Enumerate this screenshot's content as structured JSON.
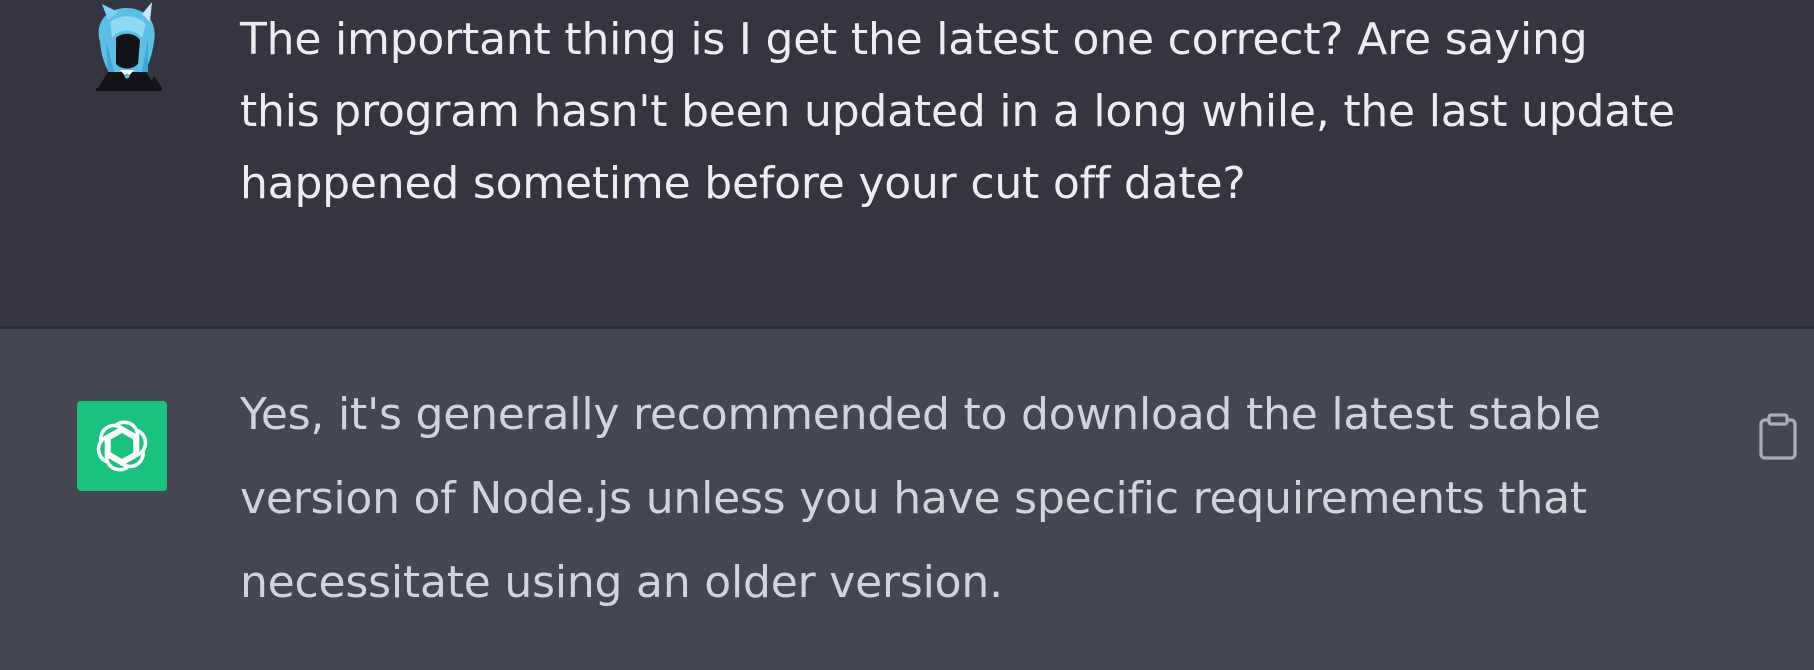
{
  "conversation": {
    "user_message": {
      "avatar_icon": "anime-character-avatar-icon",
      "text": "The important thing is I get the latest one correct? Are saying this program hasn't been updated in a long while, the last update happened sometime before your cut off date?"
    },
    "assistant_message": {
      "avatar_icon": "openai-logo-icon",
      "avatar_color": "#19c37d",
      "text": "Yes, it's generally recommended to download the latest stable version of Node.js unless you have specific requirements that necessitate using an older version.",
      "copy_icon": "clipboard-icon"
    }
  },
  "colors": {
    "user_bg": "#343541",
    "assistant_bg": "#444654",
    "user_text": "#ececf1",
    "assistant_text": "#d1d5db"
  }
}
